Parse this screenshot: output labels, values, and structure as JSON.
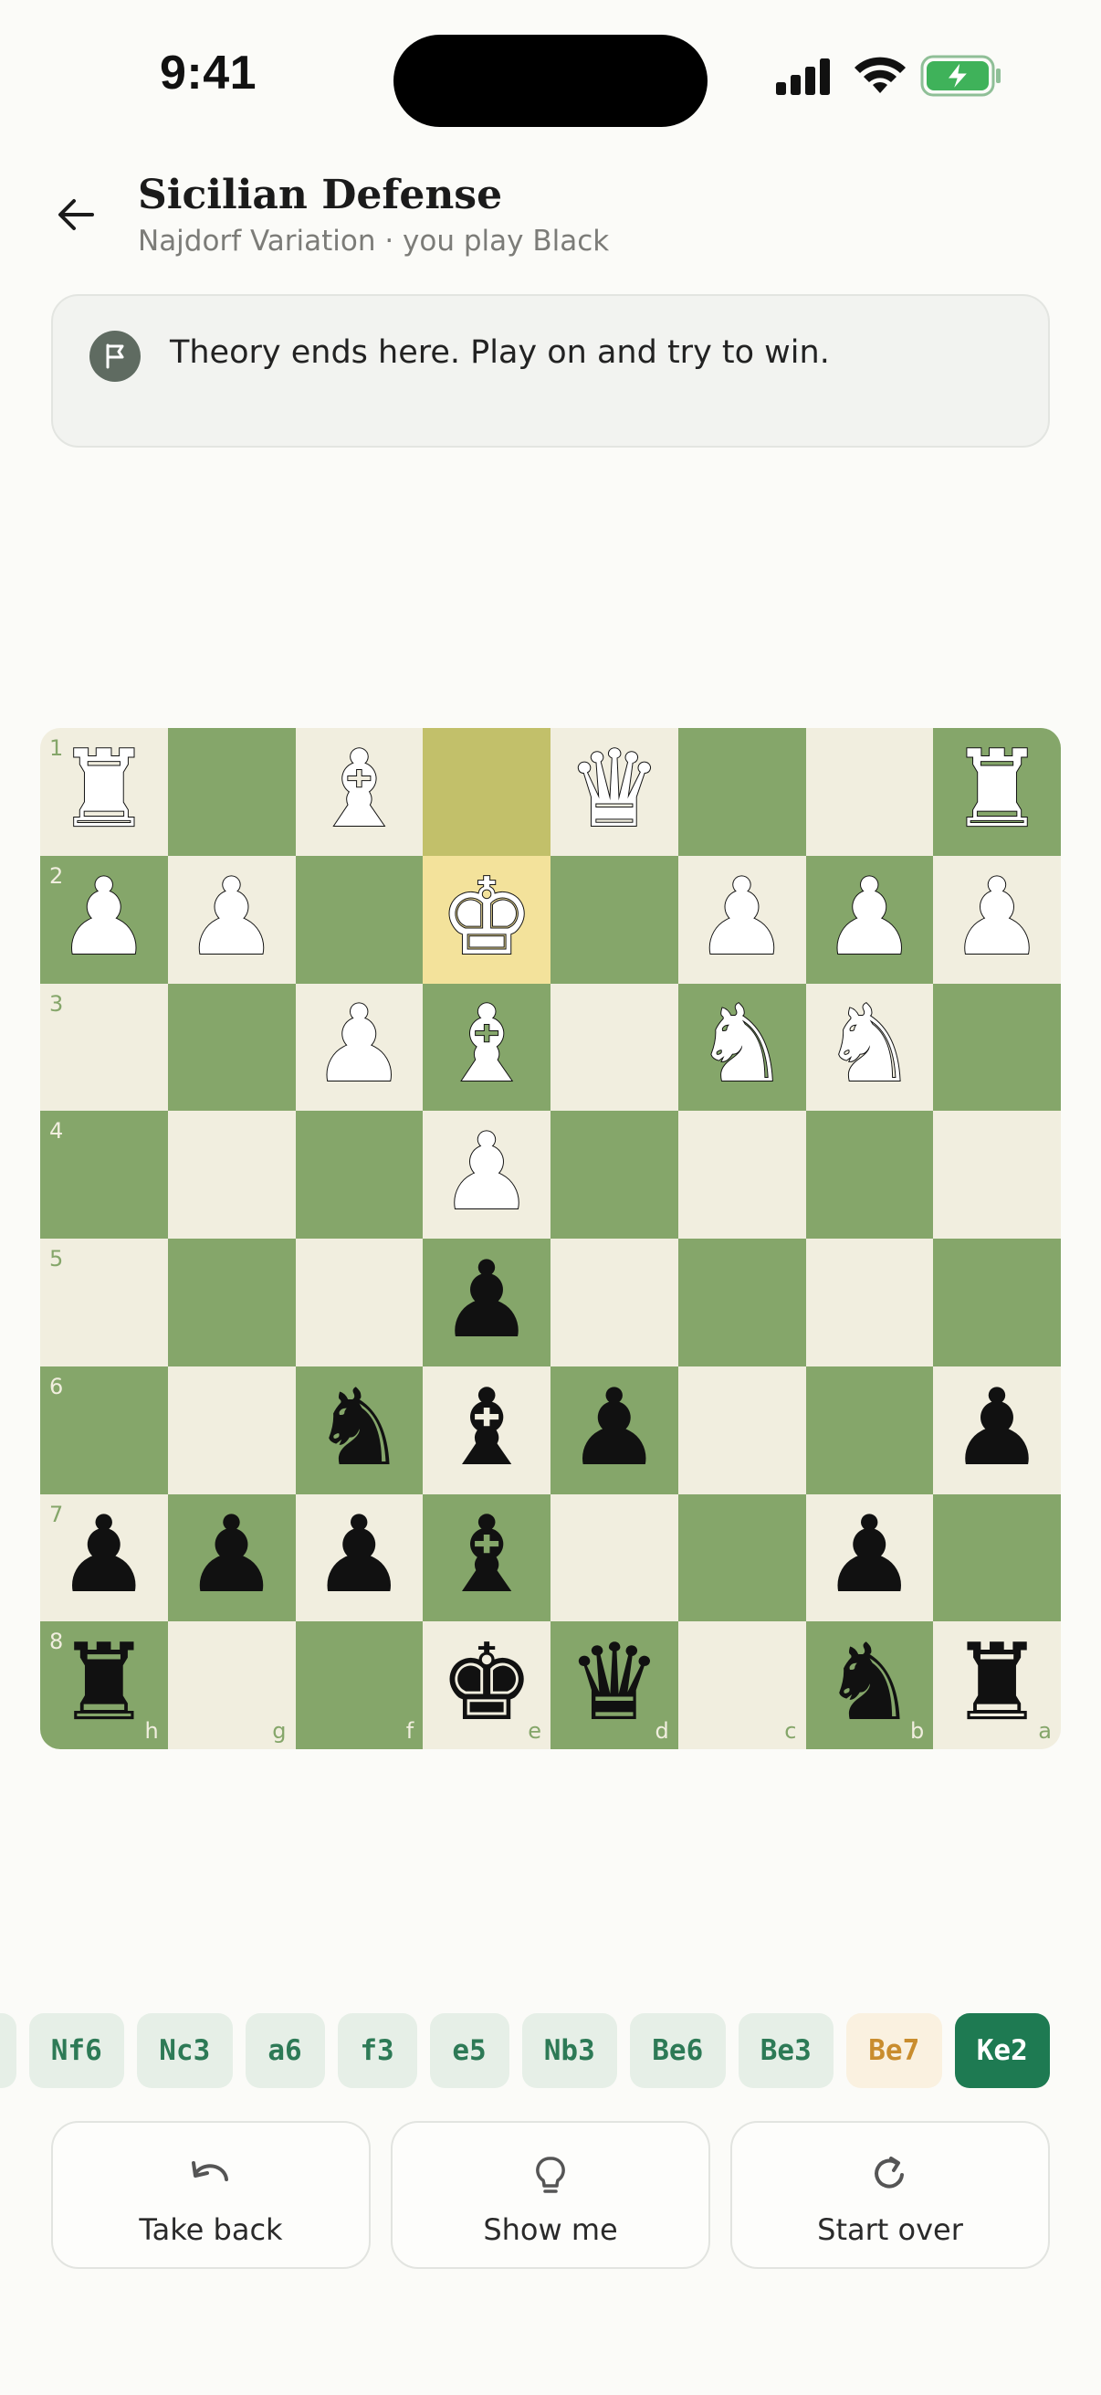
{
  "status_bar": {
    "time": "9:41"
  },
  "header": {
    "title": "Sicilian Defense",
    "subtitle": "Najdorf Variation · you play Black"
  },
  "hint": {
    "text": "Theory ends here. Play on and try to win."
  },
  "board": {
    "orientation": "black",
    "ranks": [
      "1",
      "2",
      "3",
      "4",
      "5",
      "6",
      "7",
      "8"
    ],
    "files": [
      "h",
      "g",
      "f",
      "e",
      "d",
      "c",
      "b",
      "a"
    ],
    "rows": [
      [
        "wR",
        "",
        "wB",
        "",
        "wQ",
        "",
        "",
        "wR"
      ],
      [
        "wP",
        "wP",
        "",
        "wK",
        "",
        "wP",
        "wP",
        "wP"
      ],
      [
        "",
        "",
        "wP",
        "wB",
        "",
        "wN",
        "wN",
        ""
      ],
      [
        "",
        "",
        "",
        "wP",
        "",
        "",
        "",
        ""
      ],
      [
        "",
        "",
        "",
        "bP",
        "",
        "",
        "",
        ""
      ],
      [
        "",
        "",
        "bN",
        "bB",
        "bP",
        "",
        "",
        "bP"
      ],
      [
        "bP",
        "bP",
        "bP",
        "bB",
        "",
        "",
        "bP",
        ""
      ],
      [
        "bR",
        "",
        "",
        "bK",
        "bQ",
        "",
        "bN",
        "bR"
      ]
    ],
    "highlight_from": [
      0,
      3
    ],
    "highlight_to": [
      1,
      3
    ]
  },
  "moves": [
    {
      "san": "",
      "state": "normal"
    },
    {
      "san": "Nf6",
      "state": "normal"
    },
    {
      "san": "Nc3",
      "state": "normal"
    },
    {
      "san": "a6",
      "state": "normal"
    },
    {
      "san": "f3",
      "state": "normal"
    },
    {
      "san": "e5",
      "state": "normal"
    },
    {
      "san": "Nb3",
      "state": "normal"
    },
    {
      "san": "Be6",
      "state": "normal"
    },
    {
      "san": "Be3",
      "state": "normal"
    },
    {
      "san": "Be7",
      "state": "warn"
    },
    {
      "san": "Ke2",
      "state": "current"
    }
  ],
  "actions": {
    "take_back": "Take back",
    "show_me": "Show me",
    "start_over": "Start over"
  },
  "colors": {
    "light_square": "#f1eedf",
    "dark_square": "#85a66a",
    "accent": "#1e7a52"
  }
}
